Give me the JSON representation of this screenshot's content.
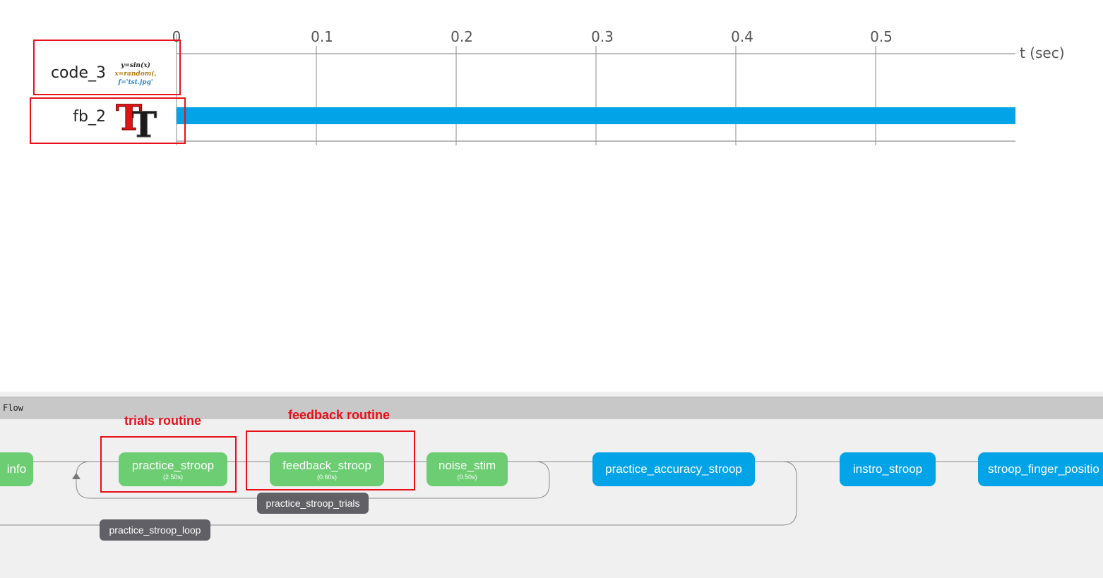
{
  "timeline": {
    "unit_label": "t (sec)",
    "ticks": [
      "0",
      "0.1",
      "0.2",
      "0.3",
      "0.4",
      "0.5"
    ],
    "components": [
      {
        "name": "code_3",
        "icon": "code-icon"
      },
      {
        "name": "fb_2",
        "icon": "text-icon",
        "bar_start_sec": 0,
        "bar_end_sec": 0.6
      }
    ],
    "code_icon_lines": [
      "y=sin(x)",
      "x=random(,",
      "f='tst.jpg'"
    ],
    "highlight_color": "#e8101a",
    "bar_color": "#03a3e7"
  },
  "flow": {
    "title": "Flow",
    "routines": {
      "info": {
        "label": "info"
      },
      "practice_stroop": {
        "label": "practice_stroop",
        "duration": "(2.50s)"
      },
      "feedback_stroop": {
        "label": "feedback_stroop",
        "duration": "(0.60s)"
      },
      "noise_stim": {
        "label": "noise_stim",
        "duration": "(0.50s)"
      },
      "practice_accuracy_stroop": {
        "label": "practice_accuracy_stroop"
      },
      "instro_stroop": {
        "label": "instro_stroop"
      },
      "stroop_finger_position": {
        "label": "stroop_finger_positio"
      }
    },
    "loops": {
      "trials": {
        "label": "practice_stroop_trials"
      },
      "outer": {
        "label": "practice_stroop_loop"
      }
    },
    "annotations": {
      "trials_routine": "trials routine",
      "feedback_routine": "feedback routine"
    },
    "colors": {
      "routine_green": "#6ccd72",
      "routine_blue": "#03a3e7",
      "loop_label": "#606066"
    }
  }
}
